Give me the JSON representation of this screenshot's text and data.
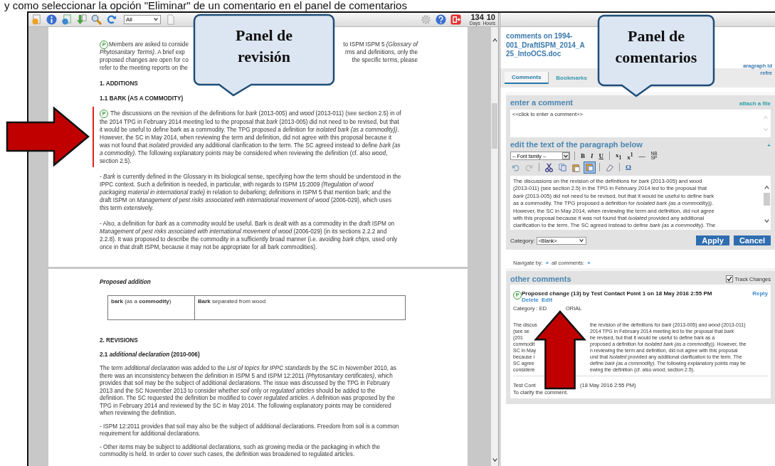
{
  "caption": "y como seleccionar la opción \"Eliminar\" de un comentario en el panel de comentarios",
  "toolbar": {
    "filter": "All",
    "days": "134",
    "hours": "10",
    "days_label": "Days",
    "hours_label": "Hours"
  },
  "document": {
    "pages": [
      {
        "blocks": [
          {
            "kind": "para",
            "marker": "P",
            "changed": false,
            "lines": [
              {
                "left": "Members are asked to conside",
                "right": "to ISPM ISPM 5 *(Glossary of*"
              },
              {
                "left": "*Phytosanitary Terms)*. A brief exp",
                "right": "rms and definitions, only the"
              },
              {
                "left": "proposed changes are open for co",
                "right": "the specific terms, please"
              },
              "refer to the meeting reports on the"
            ]
          },
          {
            "kind": "heading",
            "text": "1. ADDITIONS"
          },
          {
            "kind": "heading",
            "text": "1.1 BARK (AS A COMMODITY)"
          },
          {
            "kind": "para",
            "marker": "P",
            "changed": true,
            "lines": [
              "The discussions on the revision of the definitions for *bark* (2013-005) and *wood* (2013-011) (see section 2.5) in of",
              "the 2014 TPG in February 2014 meeting led to the proposal that *bark* (2013-005) did not need to be revised, but that",
              "it would be useful to define bark as a commodity. The TPG proposed a definition for *isolated bark (as a commodity))*.",
              "However, the SC in May 2014, when reviewing the term and definition, did not agree with this proposal because it",
              "was not found that *isolated* provided any additional clarification to the term. The SC agreed instead to define *bark (as*",
              "*a commodity)*. The following explanatory points may be considered when reviewing the definition (cf. also *wood*,",
              "section 2.5)."
            ]
          },
          {
            "kind": "para",
            "changed": false,
            "lines": [
              "- *Bark* is currently defined in the Glossary in its biological sense, specifying how the term should be understood in the",
              "IPPC context. Such a definition is needed, in particular, with regards to ISPM 15:2009 *(Regulation of wood*",
              "*packaging material in international trade)* in relation to debarking; definitions in ISPM 5 that mention bark; and the",
              "draft ISPM on *Management of pest risks associated with international movement of wood* (2006-029), which uses",
              "this term extensively."
            ]
          },
          {
            "kind": "para",
            "changed": false,
            "lines": [
              "- Also, a definition for *bark* as a commodity would be useful. Bark is dealt with as a commodity in the draft ISPM on",
              "*Management of pest risks associated with international movement of wood* (2006-029) (in its sections 2.2.2 and",
              "2.2.8). It was proposed to describe the commodity in a sufficiently broad manner (i.e. avoiding *bark chips*, used only",
              "once in that draft ISPM, because it may not be appropriate for all bark commodities)."
            ]
          }
        ]
      },
      {
        "blocks": [
          {
            "kind": "caption",
            "text": "Proposed addition"
          },
          {
            "kind": "table",
            "rows": [
              [
                "**bark** (as a **commodity**)",
                "**Bark** separated from wood"
              ]
            ]
          },
          {
            "kind": "heading",
            "text": "2. REVISIONS"
          },
          {
            "kind": "heading",
            "text": "2.1 *additional declaration* (2010-006)"
          },
          {
            "kind": "para",
            "changed": false,
            "lines": [
              "The term *additional declaration* was added to the *List of topics for IPPC standards* by the SC in November 2010, as",
              "there was an inconsistency between the definition in ISPM 5 and ISPM 12:2011 *(Phytosanitary certificates)*, which",
              "provides that soil may be the subject of additional declarations. The issue was discussed by the TPG in February",
              "2013 and the SC November 2013 to consider whether *soil* only or *regulated articles* should be added to the",
              "definition. The SC requested the definition be modified to cover *regulated articles*. A definition was proposed by the",
              "TPG in February 2014 and reviewed by the SC in May 2014. The following explanatory points may be considered",
              "when reviewing the definition."
            ]
          },
          {
            "kind": "para",
            "changed": false,
            "lines": [
              "- ISPM 12:2011 provides that soil may also be the subject of additional declarations. Freedom from soil is a common",
              "requirement for additional declarations."
            ]
          },
          {
            "kind": "para",
            "changed": false,
            "lines": [
              "- Other items may be subject to additional declarations, such as growing media or the packaging in which the",
              "commodity is held. In order to cover such cases, the definition was broadened to regulated articles."
            ]
          }
        ]
      }
    ]
  },
  "comments_panel": {
    "title_lines": [
      "comments on 1994-",
      "001_DraftISPM_2014_A",
      "25_IntoOCS.doc"
    ],
    "paragraph_id": "aragraph Id",
    "refresh": "refre",
    "tabs": [
      {
        "label": "Comments",
        "selected": true
      },
      {
        "label": "Bookmarks",
        "selected": false
      }
    ],
    "enter_header": "enter a comment",
    "attach": "attach a file",
    "placeholder": "<<click to enter a comment>>",
    "edit_header": "edit the text of the paragraph below",
    "expand": "+",
    "font_select": "-- Font family --",
    "format_buttons": [
      "B",
      "I",
      "U",
      "x$_{1}$",
      "x$^{1}$",
      "—",
      "NB SP"
    ],
    "edit_tools": [
      {
        "selected": false
      },
      {
        "selected": false
      },
      {
        "selected": false
      },
      {
        "selected": false
      },
      {
        "selected": false
      },
      {
        "selected": true
      },
      {
        "selected": false
      }
    ],
    "special_char": "Ω",
    "edit_lines": [
      "The discussions on the revision of the definitions for *bark* (2013-005) and wood",
      "(2013-011) (see section 2.5) in the TPG in February 2014 led to the proposal that",
      "*bark* (2013-005) did not need to be revised, but that it would be useful to define bark",
      "as a commodity. The TPG proposed a definition for *isolated bark (as a commodity))*.",
      "However, the SC in May 2014, when reviewing the term and definition, did not agree",
      "with this proposal because it was not found that *isolated* provided any additional",
      "clarification to the term. The SC agreed instead to define *bark (as a commodity)*. The"
    ],
    "category_label": "Category:",
    "category_value": "<Blank>",
    "buttons": [
      "Apply",
      "Cancel"
    ],
    "navigate": {
      "label": "Navigate by:",
      "prev": "«",
      "all": "all comments:",
      "next": "»"
    },
    "other_header": "other comments",
    "track_changes": {
      "label": "Track Changes",
      "checked": true
    },
    "comment": {
      "marker": "P",
      "title": "Proposed change (13) by Test Contact Point 1 on 18 May 2016 2:55 PM",
      "reply": "Reply",
      "actions": [
        "Delete",
        "Edit"
      ],
      "category_left": "Category : ED",
      "category_right": "ORIAL",
      "body": [
        {
          "left": "The discus",
          "right": "the revision of the definitions for *bark* (2013-005) and *wood* (2013-011)"
        },
        {
          "left": "(see se",
          "right": "2014 TPG in February 2014 meeting led to the proposal that *bark*"
        },
        {
          "left": "(201",
          "right": "be revised, but that it would be useful to define bark as a"
        },
        {
          "left": "commodit",
          "right": "proposed a definition for *isolated bark (as a commodity))*. However, the"
        },
        {
          "left": "SC in May",
          "right": "n reviewing the term and definition, did not agree with this proposal"
        },
        {
          "left": "because i",
          "right": "und that *isolated* provided any additional clarification to the term. The"
        },
        {
          "left": "SC agree",
          "right": "define *bark (as a commodity)*. The following explanatory points may be"
        },
        {
          "left": "considere",
          "right": "ewing the definition (cf. also *wood*, section 2.5)."
        }
      ],
      "reply_author_left": "Test Cont",
      "reply_author_right": "(18 May 2016 2:55 PM)",
      "reply_text": "To clarify the comment."
    }
  },
  "callouts": [
    {
      "text": "Panel de revisión"
    },
    {
      "text": "Panel de comentarios"
    }
  ]
}
